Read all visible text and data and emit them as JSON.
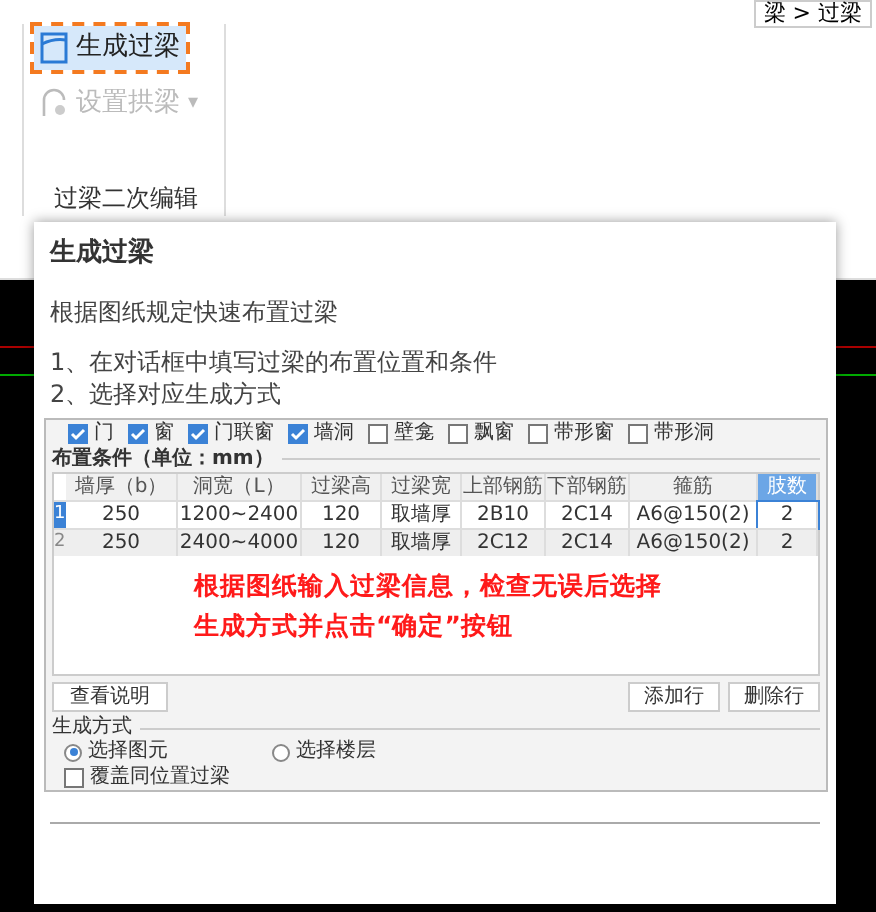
{
  "breadcrumb": "梁 > 过梁",
  "ribbon": {
    "buttons": [
      {
        "label": "生成过梁",
        "highlighted": true,
        "disabled": false
      },
      {
        "label": "设置拱梁",
        "highlighted": false,
        "disabled": true,
        "dropdown": "▾"
      }
    ],
    "group_label": "过梁二次编辑"
  },
  "tooltip": {
    "title": "生成过梁",
    "description": "根据图纸规定快速布置过梁",
    "steps": [
      "1、在对话框中填写过梁的布置位置和条件",
      "2、选择对应生成方式"
    ],
    "dialog": {
      "checkboxes": [
        {
          "label": "门",
          "checked": true
        },
        {
          "label": "窗",
          "checked": true
        },
        {
          "label": "门联窗",
          "checked": true
        },
        {
          "label": "墙洞",
          "checked": true
        },
        {
          "label": "壁龛",
          "checked": false
        },
        {
          "label": "飘窗",
          "checked": false
        },
        {
          "label": "带形窗",
          "checked": false
        },
        {
          "label": "带形洞",
          "checked": false
        }
      ],
      "section_label": "布置条件（单位：mm）",
      "columns": [
        "墙厚（b）",
        "洞宽（L）",
        "过梁高",
        "过梁宽",
        "上部钢筋",
        "下部钢筋",
        "箍筋",
        "肢数"
      ],
      "rows": [
        {
          "index": "1",
          "selected": true,
          "cells": [
            "250",
            "1200~2400",
            "120",
            "取墙厚",
            "2B10",
            "2C14",
            "A6@150(2)",
            "2"
          ]
        },
        {
          "index": "2",
          "selected": false,
          "cells": [
            "250",
            "2400~4000",
            "120",
            "取墙厚",
            "2C12",
            "2C14",
            "A6@150(2)",
            "2"
          ]
        }
      ],
      "annotation": "根据图纸输入过梁信息，检查无误后选择生成方式并点击“确定”按钮",
      "left_button": "查看说明",
      "right_buttons": [
        "添加行",
        "删除行"
      ],
      "method_label": "生成方式",
      "radios": [
        {
          "label": "选择图元",
          "selected": true
        },
        {
          "label": "选择楼层",
          "selected": false
        }
      ],
      "override": {
        "label": "覆盖同位置过梁",
        "checked": false
      }
    }
  }
}
